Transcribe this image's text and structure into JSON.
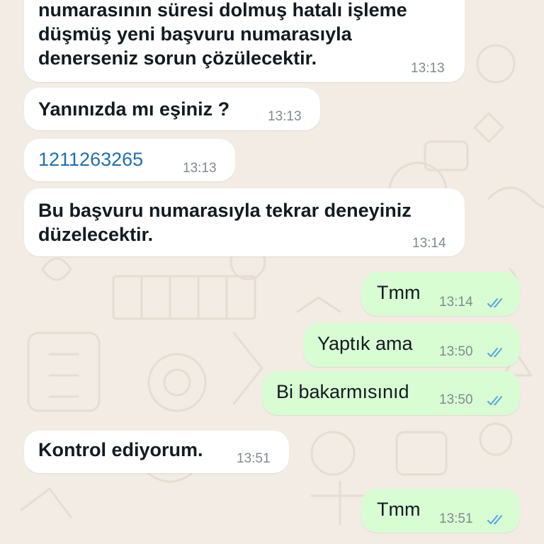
{
  "chat": {
    "wallpaper_color": "#f2ece4",
    "incoming_bubble_color": "#ffffff",
    "outgoing_bubble_color": "#d9fdd3",
    "tick_color": "#53a6e6",
    "messages": [
      {
        "direction": "incoming",
        "lines": [
          "numarasının süresi dolmuş hatalı işleme",
          "düşmüş yeni başvuru numarasıyla",
          "denerseniz sorun çözülecektir."
        ],
        "time": "13:13"
      },
      {
        "direction": "incoming",
        "text": "Yanınızda mı eşiniz ?",
        "time": "13:13"
      },
      {
        "direction": "incoming",
        "text": "1211263265",
        "time": "13:13"
      },
      {
        "direction": "incoming",
        "lines": [
          "Bu başvuru numarasıyla tekrar deneyiniz",
          "düzelecektir."
        ],
        "time": "13:14"
      },
      {
        "direction": "outgoing",
        "text": "Tmm",
        "time": "13:14",
        "status": "read"
      },
      {
        "direction": "outgoing",
        "text": "Yaptık ama",
        "time": "13:50",
        "status": "read"
      },
      {
        "direction": "outgoing",
        "text": "Bi bakarmısınıd",
        "time": "13:50",
        "status": "read"
      },
      {
        "direction": "incoming",
        "text": "Kontrol ediyorum.",
        "time": "13:51"
      },
      {
        "direction": "outgoing",
        "text": "Tmm",
        "time": "13:51",
        "status": "read"
      }
    ]
  }
}
